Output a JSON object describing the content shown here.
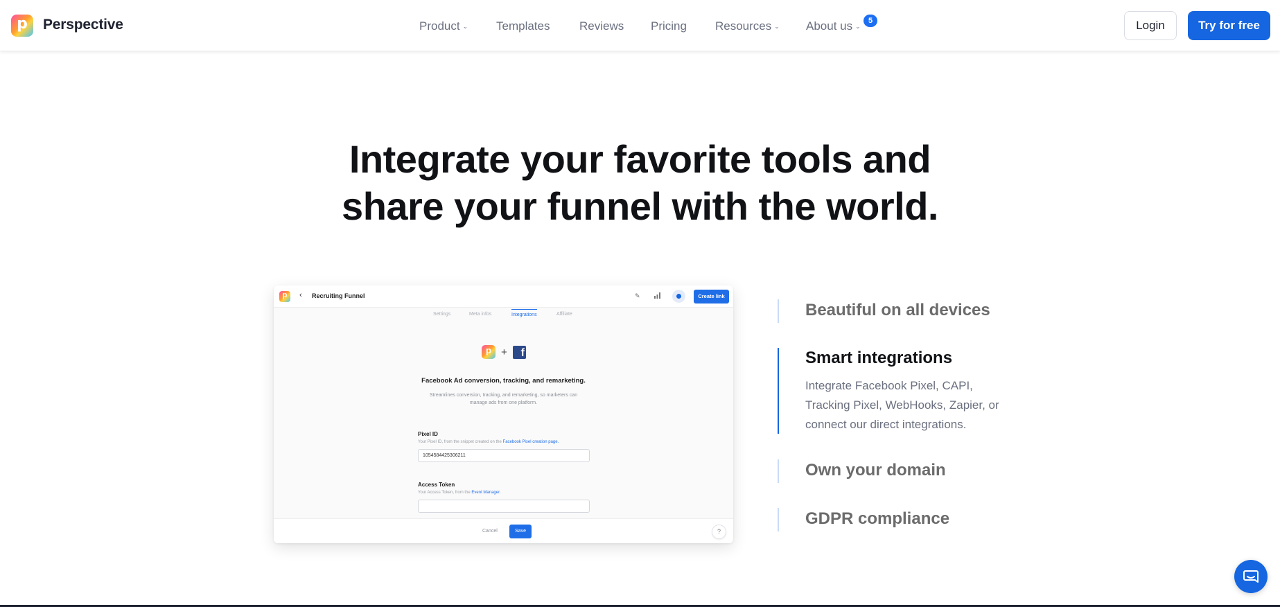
{
  "header": {
    "brand": "Perspective",
    "nav": {
      "product": "Product",
      "templates": "Templates",
      "reviews": "Reviews",
      "pricing": "Pricing",
      "resources": "Resources",
      "about": "About us"
    },
    "about_badge": "5",
    "login": "Login",
    "try": "Try for free"
  },
  "hero": {
    "line1": "Integrate your favorite tools and",
    "line2": "share your funnel with the world."
  },
  "mockup": {
    "funnel_title": "Recruiting Funnel",
    "create_link": "Create link",
    "tabs": [
      "Settings",
      "Meta infos",
      "Integrations",
      "Affiliate"
    ],
    "active_tab": "Integrations",
    "plus": "+",
    "fb_letter": "f",
    "heading": "Facebook Ad conversion, tracking, and remarketing.",
    "subtext": "Streamlines conversion, tracking, and remarketing, so marketers can manage ads from one platform.",
    "pixel_label": "Pixel ID",
    "pixel_help": "Your Pixel ID, from the snippet created on the",
    "pixel_help_link": "Facebook Pixel creation page.",
    "pixel_value": "1054584425306211",
    "token_label": "Access Token",
    "token_help": "Your Access Token, from the",
    "token_help_link": "Event Manager.",
    "token_value": "",
    "cancel": "Cancel",
    "save": "Save",
    "help": "?"
  },
  "features": [
    {
      "title": "Beautiful on all devices",
      "active": false
    },
    {
      "title": "Smart integrations",
      "active": true,
      "description": "Integrate Facebook Pixel, CAPI, Tracking Pixel, WebHooks, Zapier, or connect our direct integrations."
    },
    {
      "title": "Own your domain",
      "active": false
    },
    {
      "title": "GDPR compliance",
      "active": false
    }
  ],
  "colors": {
    "accent": "#1566e0",
    "text": "#111216",
    "muted": "#6b7080"
  }
}
